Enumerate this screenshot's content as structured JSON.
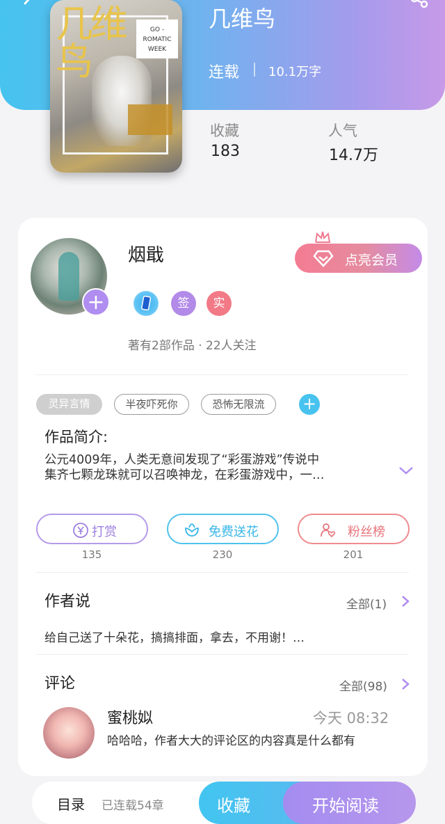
{
  "book": {
    "title": "几维鸟",
    "status": "连载",
    "word_count": "10.1万字",
    "cover": {
      "big_title": "几维鸟",
      "label": "GO - ROMATIC WEEK"
    },
    "stats": {
      "favorites_label": "收藏",
      "favorites_value": "183",
      "popularity_label": "人气",
      "popularity_value": "14.7万"
    }
  },
  "author": {
    "name": "烟戢",
    "vip_button": "点亮会员",
    "badges": [
      "签",
      "实"
    ],
    "meta": "著有2部作品 · 22人关注"
  },
  "tags": [
    "灵异言情",
    "半夜吓死你",
    "恐怖无限流"
  ],
  "intro": {
    "title": "作品简介:",
    "line1": "公元4009年，人类无意间发现了“彩蛋游戏”传说中",
    "line2": "集齐七颗龙珠就可以召唤神龙，在彩蛋游戏中，一…"
  },
  "actions": [
    {
      "label": "打赏",
      "count": "135",
      "icon": "yen-coin-icon"
    },
    {
      "label": "免费送花",
      "count": "230",
      "icon": "flower-icon"
    },
    {
      "label": "粉丝榜",
      "count": "201",
      "icon": "fans-heart-icon"
    }
  ],
  "author_says": {
    "title": "作者说",
    "all": "全部(1)",
    "text": "给自己送了十朵花，搞搞排面，拿去，不用谢！…"
  },
  "comments": {
    "title": "评论",
    "all": "全部(98)",
    "items": [
      {
        "name": "蜜桃姒",
        "time": "今天 08:32",
        "text": "哈哈哈，作者大大的评论区的内容真是什么都有"
      }
    ]
  },
  "bottom": {
    "toc": "目录",
    "chapters": "已连载54章",
    "favorite": "收藏",
    "start_reading": "开始阅读"
  },
  "colors": {
    "header_gradient_start": "#46c3ef",
    "header_gradient_end": "#c79ae8",
    "accent_blue": "#48c2ee",
    "accent_purple": "#b08df0",
    "accent_pink": "#f47c92"
  }
}
